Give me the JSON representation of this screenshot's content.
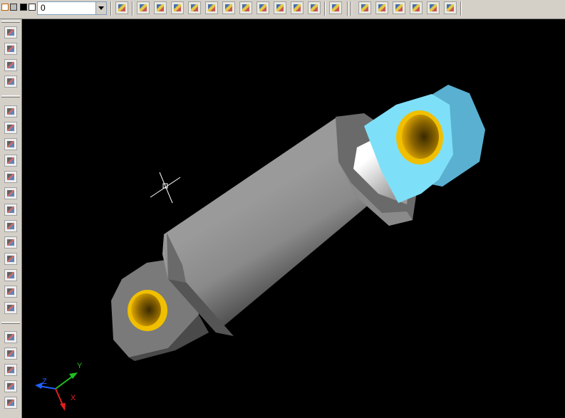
{
  "toolbar": {
    "layer_value": "0",
    "icons": [
      "undo-icon",
      "properties-icon",
      "layer-properties-icon",
      "table-icon",
      "zoom-realtime-icon",
      "render-icon",
      "light-icon",
      "scene-icon",
      "materials-icon",
      "background-icon",
      "fog-icon",
      "landscape-icon",
      "help-icon",
      "orbit-icon",
      "zoom-icon",
      "shade-icon",
      "3d-view-icon",
      "named-views-icon",
      "box-view-icon"
    ]
  },
  "side_toolbar": {
    "icons": [
      "extrude-icon",
      "revolve-icon",
      "slice-icon",
      "section-icon",
      "union-icon",
      "subtract-icon",
      "intersect-icon",
      "interfere-icon",
      "fillet-icon",
      "chamfer-icon",
      "box-icon",
      "sphere-icon",
      "cylinder-icon",
      "cone-icon",
      "wedge-icon",
      "torus-icon",
      "list-icon",
      "region-icon",
      "mass-properties-icon",
      "distance-icon",
      "id-point-icon",
      "area-icon"
    ]
  },
  "ucs": {
    "x_label": "X",
    "y_label": "Y",
    "z_label": "Z"
  },
  "colors": {
    "viewport_bg": "#000000",
    "cylinder_grey": "#8a8a8a",
    "bushing_gold": "#e8b000",
    "eye_cyan": "#7ee0f8"
  }
}
